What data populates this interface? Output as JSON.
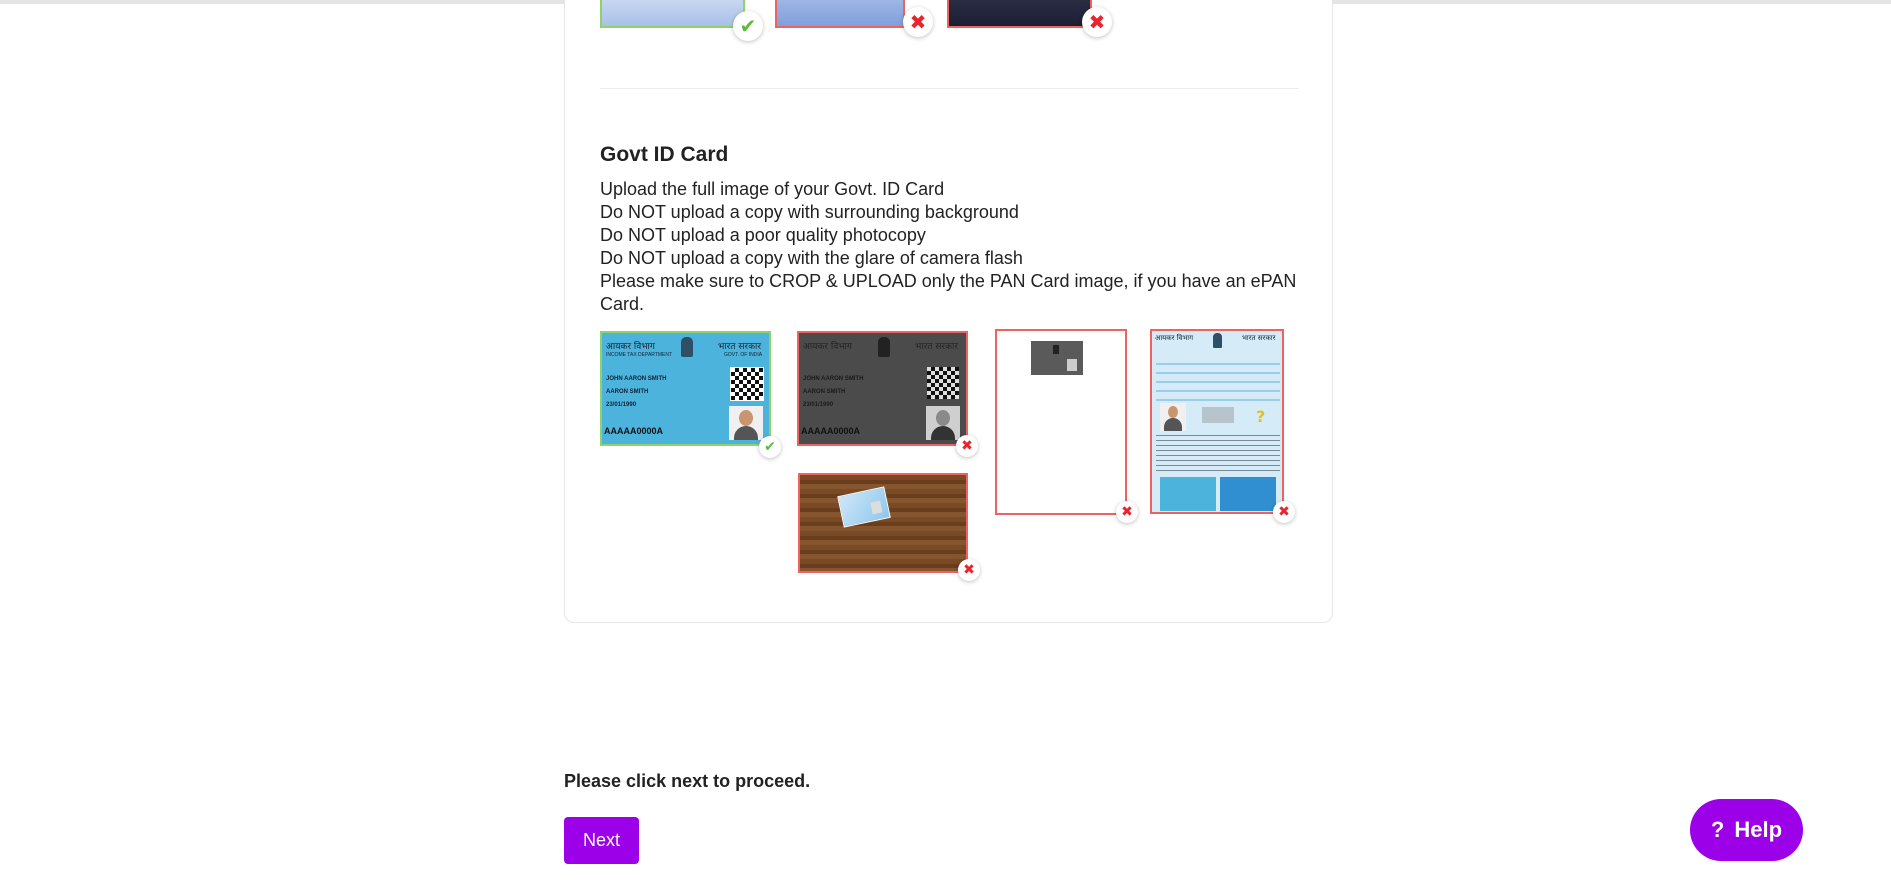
{
  "photo_examples": [
    {
      "status": "accepted",
      "icon": "check-icon",
      "glyph": "✔"
    },
    {
      "status": "rejected",
      "icon": "cross-icon",
      "glyph": "✖"
    },
    {
      "status": "rejected",
      "icon": "cross-icon",
      "glyph": "✖"
    }
  ],
  "govt_id": {
    "title": "Govt ID Card",
    "instructions": [
      "Upload the full image of your Govt. ID Card",
      "Do NOT upload a copy with surrounding background",
      "Do NOT upload a poor quality photocopy",
      "Do NOT upload a copy with the glare of camera flash",
      "Please make sure to CROP & UPLOAD only the PAN Card image, if you have an ePAN Card."
    ],
    "examples": [
      {
        "description": "full-pan-card",
        "status": "accepted",
        "glyph": "✔"
      },
      {
        "description": "dark-photocopy",
        "status": "rejected",
        "glyph": "✖"
      },
      {
        "description": "small-card-on-blank-page",
        "status": "rejected",
        "glyph": "✖"
      },
      {
        "description": "epan-full-document",
        "status": "rejected",
        "glyph": "✖"
      },
      {
        "description": "card-on-wood-background",
        "status": "rejected",
        "glyph": "✖"
      }
    ],
    "card_text": {
      "dept_hi": "आयकर विभाग",
      "govt_hi": "भारत सरकार",
      "dept_en": "INCOME TAX DEPARTMENT",
      "govt_en": "GOVT. OF INDIA",
      "name": "JOHN AARON SMITH",
      "father": "AARON SMITH",
      "dob": "23/01/1990",
      "pan": "AAAAA0000A"
    }
  },
  "footer": {
    "prompt": "Please click next to proceed.",
    "next_label": "Next"
  },
  "help": {
    "icon": "question-icon",
    "glyph": "?",
    "label": "Help"
  },
  "colors": {
    "accent": "#9b00e8",
    "ok": "#5fba3b",
    "error": "#e8242e",
    "pan_blue": "#4cb3dd"
  }
}
